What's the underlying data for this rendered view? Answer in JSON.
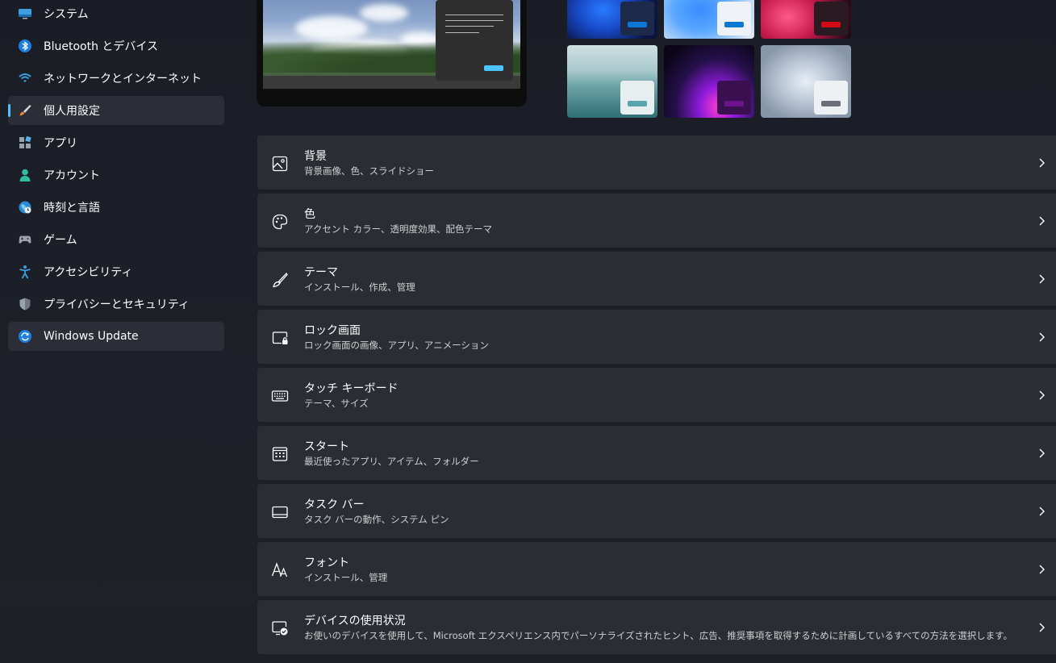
{
  "sidebar": {
    "items": [
      {
        "label": "システム",
        "icon": "monitor-icon",
        "selected": false
      },
      {
        "label": "Bluetooth とデバイス",
        "icon": "bluetooth-icon",
        "selected": false
      },
      {
        "label": "ネットワークとインターネット",
        "icon": "wifi-icon",
        "selected": false
      },
      {
        "label": "個人用設定",
        "icon": "paintbrush-icon",
        "selected": true
      },
      {
        "label": "アプリ",
        "icon": "apps-icon",
        "selected": false
      },
      {
        "label": "アカウント",
        "icon": "person-icon",
        "selected": false
      },
      {
        "label": "時刻と言語",
        "icon": "globe-clock-icon",
        "selected": false
      },
      {
        "label": "ゲーム",
        "icon": "gamepad-icon",
        "selected": false
      },
      {
        "label": "アクセシビリティ",
        "icon": "accessibility-icon",
        "selected": false
      },
      {
        "label": "プライバシーとセキュリティ",
        "icon": "shield-icon",
        "selected": false
      },
      {
        "label": "Windows Update",
        "icon": "update-icon",
        "selected": false
      }
    ]
  },
  "themes": [
    {
      "name": "bloom-blue-dark",
      "accent": "#0a78d4"
    },
    {
      "name": "bloom-blue-light",
      "accent": "#0a78d4"
    },
    {
      "name": "glow-red",
      "accent": "#d40a14"
    },
    {
      "name": "lake",
      "accent": "#5aa4b0"
    },
    {
      "name": "purple-sunrise",
      "accent": "#6b148a"
    },
    {
      "name": "flow-silver",
      "accent": "#6b6f78"
    }
  ],
  "cards": [
    {
      "title": "背景",
      "subtitle": "背景画像、色、スライドショー",
      "icon": "image-icon"
    },
    {
      "title": "色",
      "subtitle": "アクセント カラー、透明度効果、配色テーマ",
      "icon": "palette-icon"
    },
    {
      "title": "テーマ",
      "subtitle": "インストール、作成、管理",
      "icon": "brush-icon"
    },
    {
      "title": "ロック画面",
      "subtitle": "ロック画面の画像、アプリ、アニメーション",
      "icon": "lock-screen-icon"
    },
    {
      "title": "タッチ キーボード",
      "subtitle": "テーマ、サイズ",
      "icon": "keyboard-icon"
    },
    {
      "title": "スタート",
      "subtitle": "最近使ったアプリ、アイテム、フォルダー",
      "icon": "start-grid-icon"
    },
    {
      "title": "タスク バー",
      "subtitle": "タスク バーの動作、システム ピン",
      "icon": "taskbar-icon"
    },
    {
      "title": "フォント",
      "subtitle": "インストール、管理",
      "icon": "font-icon"
    },
    {
      "title": "デバイスの使用状況",
      "subtitle": "お使いのデバイスを使用して、Microsoft エクスペリエンス内でパーソナライズされたヒント、広告、推奨事項を取得するために計画しているすべての方法を選択します。",
      "icon": "device-usage-icon"
    }
  ],
  "colors": {
    "accent": "#4cc2ff",
    "card_bg": "#2b2d35",
    "selected_bg": "#2b2d37"
  }
}
